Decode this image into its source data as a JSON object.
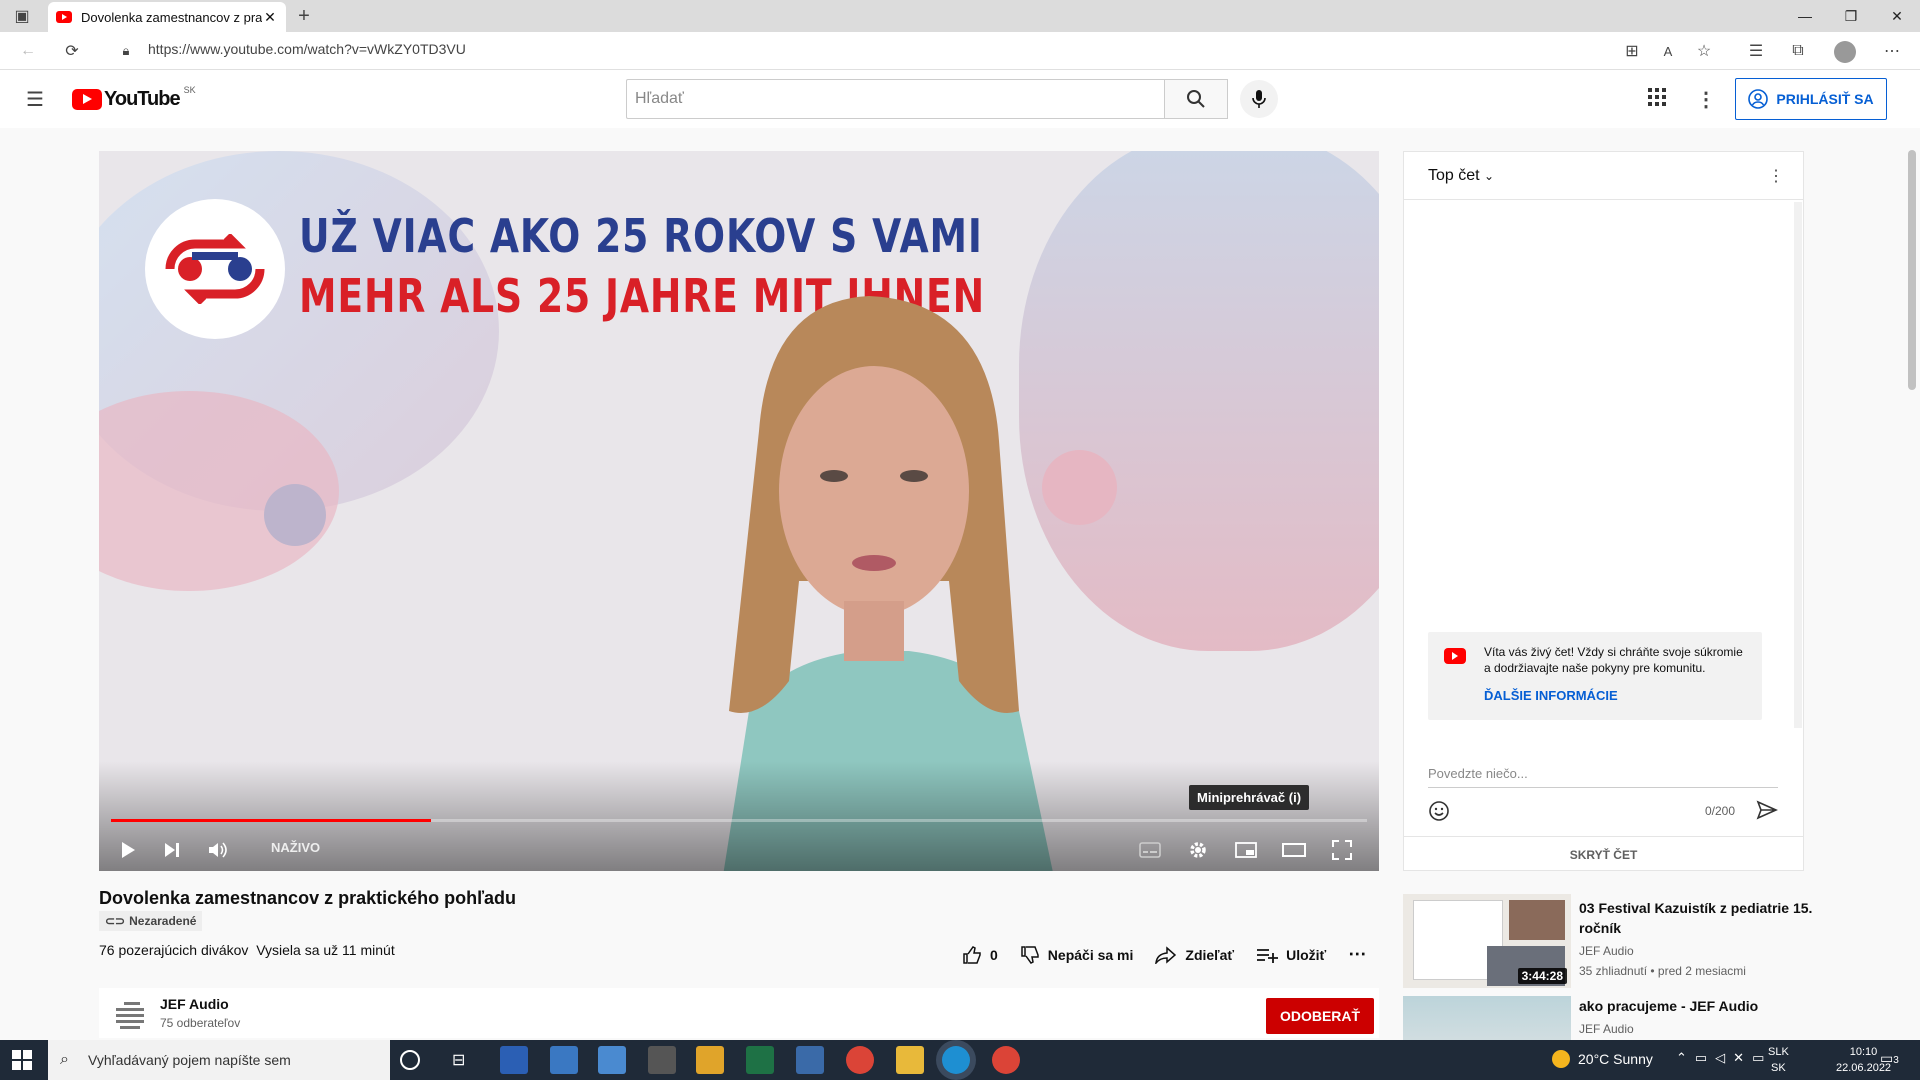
{
  "browser": {
    "tab_title": "Dovolenka zamestnancov z prak",
    "url": "https://www.youtube.com/watch?v=vWkZY0TD3VU"
  },
  "youtube": {
    "logo_text": "YouTube",
    "country_code": "SK",
    "search_placeholder": "Hľadať",
    "signin_label": "PRIHLÁSIŤ SA"
  },
  "player": {
    "banner_line1": "UŽ VIAC AKO 25 ROKOV S VAMI",
    "banner_line2": "MEHR ALS 25 JAHRE MIT IHNEN",
    "live_label": "NAŽIVO",
    "tooltip": "Miniprehrávač (i)",
    "progress_fraction": 0.255
  },
  "video": {
    "title": "Dovolenka zamestnancov z praktického pohľadu",
    "visibility": "Nezaradené",
    "viewers": "76 pozerajúcich divákov",
    "streaming_since": "Vysiela sa už 11 minút",
    "like_count": "0",
    "dislike_label": "Nepáči sa mi",
    "share_label": "Zdieľať",
    "save_label": "Uložiť"
  },
  "channel": {
    "name": "JEF Audio",
    "subscribers": "75 odberateľov",
    "subscribe_label": "ODOBERAŤ"
  },
  "chat": {
    "mode": "Top čet",
    "welcome": "Víta vás živý čet! Vždy si chráňte svoje súkromie a dodržiavajte naše pokyny pre komunitu.",
    "more_info": "ĎALŠIE INFORMÁCIE",
    "input_placeholder": "Povedzte niečo...",
    "char_count": "0/200",
    "hide_label": "SKRYŤ ČET"
  },
  "recommendations": [
    {
      "title": "03 Festival Kazuistík z pediatrie 15. ročník",
      "channel": "JEF Audio",
      "meta": "35 zhliadnutí • pred 2 mesiacmi",
      "duration": "3:44:28"
    },
    {
      "title": "ako pracujeme - JEF Audio",
      "channel": "JEF Audio",
      "meta": "",
      "duration": ""
    }
  ],
  "taskbar": {
    "search_placeholder": "Vyhľadávaný pojem napíšte sem",
    "weather": "20°C  Sunny",
    "lang1": "SLK",
    "lang2": "SK",
    "time": "10:10",
    "date": "22.06.2022",
    "notifications": "3"
  },
  "colors": {
    "accent_red": "#ff0000",
    "link_blue": "#065fd4",
    "subscribe_red": "#cc0000"
  }
}
